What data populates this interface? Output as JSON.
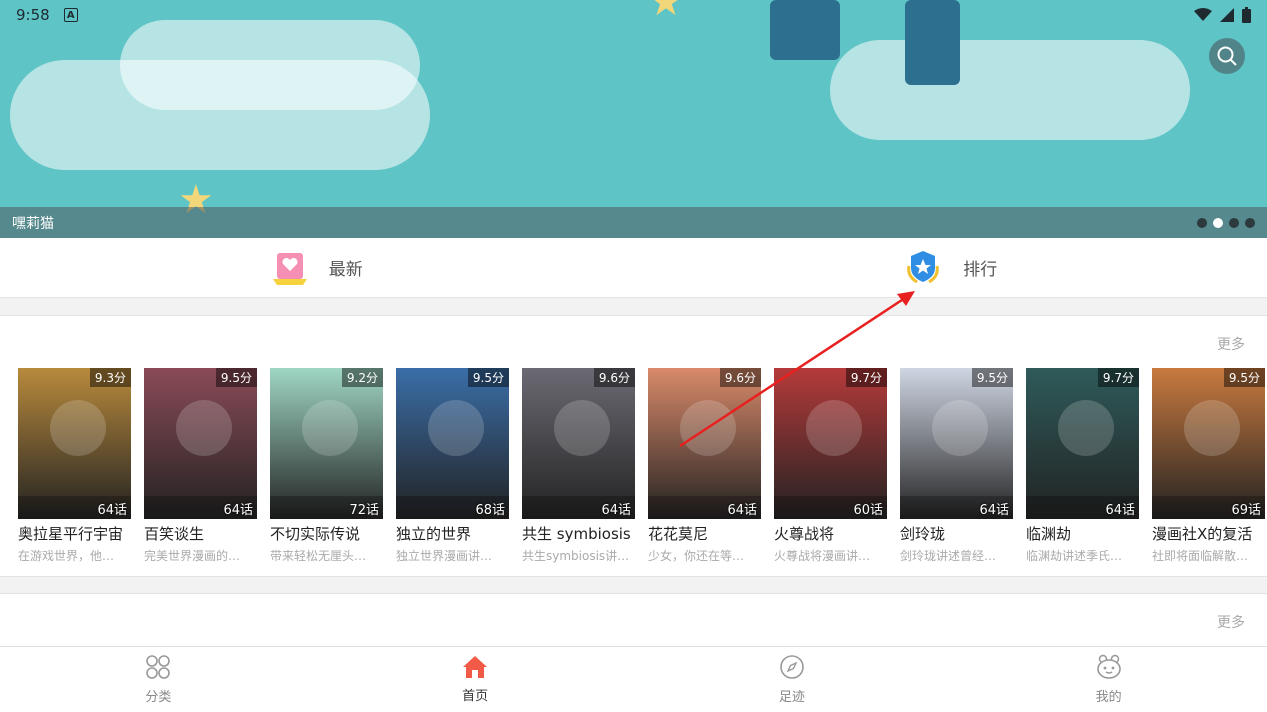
{
  "status": {
    "time": "9:58",
    "badge": "A"
  },
  "banner": {
    "caption": "嘿莉猫",
    "slide_count": 4,
    "active_slide": 1
  },
  "quicknav": [
    {
      "label": "最新",
      "icon": "newest-badge-icon"
    },
    {
      "label": "排行",
      "icon": "ranking-shield-icon"
    }
  ],
  "section1": {
    "more_label": "更多",
    "items": [
      {
        "title": "奥拉星平行宇宙",
        "desc": "在游戏世界，他…",
        "score": "9.3分",
        "episodes": "64话",
        "color": "#b88a3c"
      },
      {
        "title": "百笑谈生",
        "desc": "完美世界漫画的…",
        "score": "9.5分",
        "episodes": "64话",
        "color": "#8a4b57"
      },
      {
        "title": "不切实际传说",
        "desc": "带来轻松无厘头…",
        "score": "9.2分",
        "episodes": "72话",
        "color": "#9fd6c4"
      },
      {
        "title": "独立的世界",
        "desc": "独立世界漫画讲…",
        "score": "9.5分",
        "episodes": "68话",
        "color": "#3a6ea8"
      },
      {
        "title": "共生 symbiosis",
        "desc": "共生symbiosis讲…",
        "score": "9.6分",
        "episodes": "64话",
        "color": "#6b6a73"
      },
      {
        "title": "花花莫尼",
        "desc": "少女，你还在等…",
        "score": "9.6分",
        "episodes": "64话",
        "color": "#d98a6a"
      },
      {
        "title": "火尊战将",
        "desc": "火尊战将漫画讲…",
        "score": "9.7分",
        "episodes": "60话",
        "color": "#b53a3a"
      },
      {
        "title": "剑玲珑",
        "desc": "剑玲珑讲述曾经…",
        "score": "9.5分",
        "episodes": "64话",
        "color": "#cfd6e3"
      },
      {
        "title": "临渊劫",
        "desc": "临渊劫讲述季氏…",
        "score": "9.7分",
        "episodes": "64话",
        "color": "#2f5a5a"
      },
      {
        "title": "漫画社X的复活",
        "desc": "社即将面临解散…",
        "score": "9.5分",
        "episodes": "69话",
        "color": "#c97a3f"
      }
    ]
  },
  "section2": {
    "more_label": "更多"
  },
  "bottomnav": [
    {
      "label": "分类",
      "icon": "category-icon",
      "active": false
    },
    {
      "label": "首页",
      "icon": "home-icon",
      "active": true
    },
    {
      "label": "足迹",
      "icon": "compass-icon",
      "active": false
    },
    {
      "label": "我的",
      "icon": "profile-icon",
      "active": false
    }
  ],
  "colors": {
    "accent": "#f05a47",
    "banner": "#5ec4c6",
    "annotation_arrow": "#e8201f"
  }
}
